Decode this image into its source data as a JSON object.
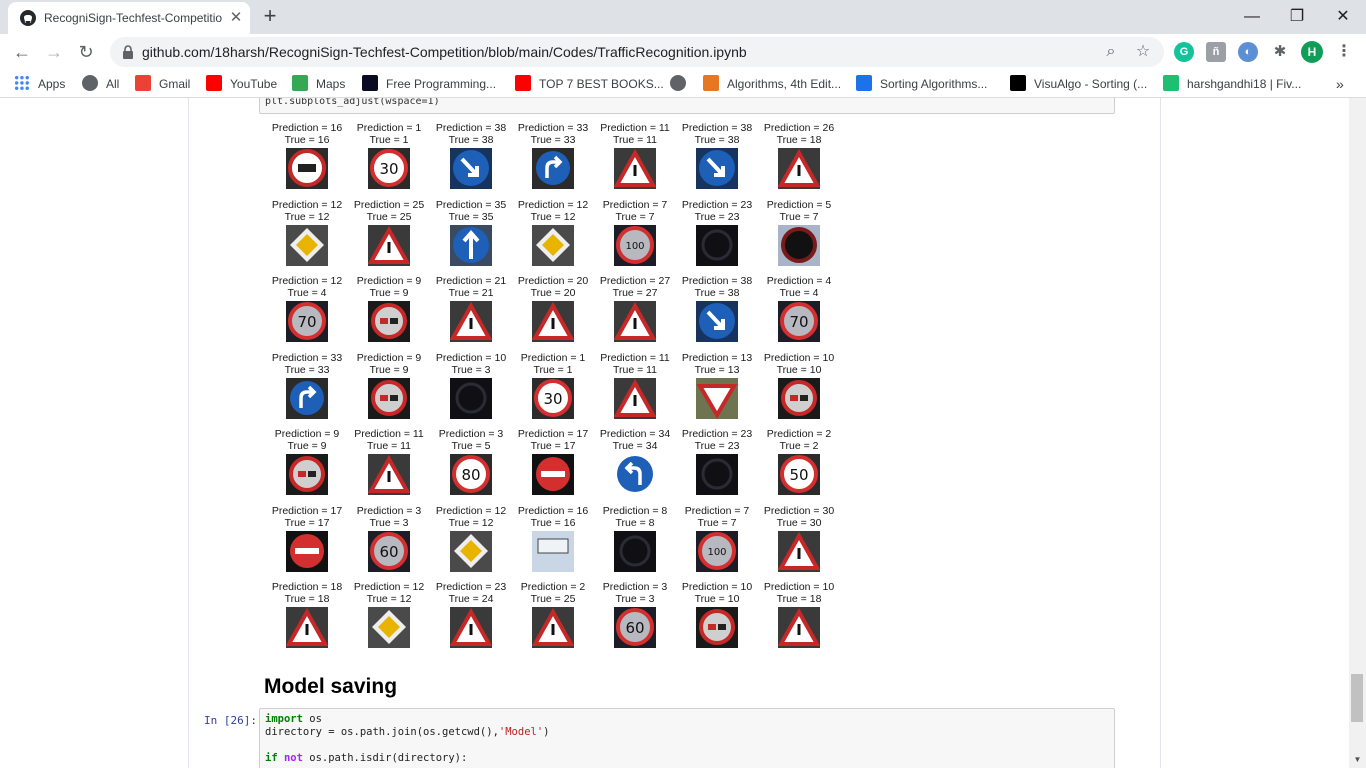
{
  "tab": {
    "title": "RecogniSign-Techfest-Competitio",
    "close": "✕",
    "new": "+"
  },
  "window": {
    "minimize": "—",
    "restore": "❐",
    "close": "✕"
  },
  "toolbar": {
    "url_host": "github.com",
    "url_path": "/18harsh/RecogniSign-Techfest-Competition/blob/main/Codes/TrafficRecognition.ipynb",
    "profile_initial": "H"
  },
  "bookmarks": [
    {
      "label": "Apps",
      "icon": "apps-grid-icon",
      "color": "#4285f4"
    },
    {
      "label": "All",
      "icon": "globe-icon",
      "color": "#5f6368"
    },
    {
      "label": "Gmail",
      "icon": "gmail-icon",
      "color": "#ea4335"
    },
    {
      "label": "YouTube",
      "icon": "youtube-icon",
      "color": "#ff0000"
    },
    {
      "label": "Maps",
      "icon": "maps-pin-icon",
      "color": "#34a853"
    },
    {
      "label": "Free Programming...",
      "icon": "fcc-icon",
      "color": "#0a0a23"
    },
    {
      "label": "TOP 7 BEST BOOKS...",
      "icon": "youtube-icon",
      "color": "#ff0000"
    },
    {
      "label": "",
      "icon": "globe-icon",
      "color": "#5f6368"
    },
    {
      "label": "Algorithms, 4th Edit...",
      "icon": "princeton-shield-icon",
      "color": "#e87722"
    },
    {
      "label": "Sorting Algorithms...",
      "icon": "sorting-icon",
      "color": "#1a73e8"
    },
    {
      "label": "VisuAlgo - Sorting (...",
      "icon": "visualgo-icon",
      "color": "#000000"
    },
    {
      "label": "harshgandhi18 | Fiv...",
      "icon": "fiverr-icon",
      "color": "#1dbf73"
    }
  ],
  "notebook": {
    "prev_code": "plt.subplots_adjust(wspace=1)",
    "grid": [
      [
        {
          "p": "Prediction = 16",
          "t": "True = 16",
          "sign": "truck"
        },
        {
          "p": "Prediction = 1",
          "t": "True = 1",
          "sign": "30"
        },
        {
          "p": "Prediction = 38",
          "t": "True = 38",
          "sign": "keepright"
        },
        {
          "p": "Prediction = 33",
          "t": "True = 33",
          "sign": "turnright"
        },
        {
          "p": "Prediction = 11",
          "t": "True = 11",
          "sign": "tri"
        },
        {
          "p": "Prediction = 38",
          "t": "True = 38",
          "sign": "keepright"
        },
        {
          "p": "Prediction = 26",
          "t": "True = 18",
          "sign": "tri"
        }
      ],
      [
        {
          "p": "Prediction = 12",
          "t": "True = 12",
          "sign": "priority"
        },
        {
          "p": "Prediction = 25",
          "t": "True = 25",
          "sign": "tri"
        },
        {
          "p": "Prediction = 35",
          "t": "True = 35",
          "sign": "ahead"
        },
        {
          "p": "Prediction = 12",
          "t": "True = 12",
          "sign": "priority"
        },
        {
          "p": "Prediction = 7",
          "t": "True = 7",
          "sign": "100"
        },
        {
          "p": "Prediction = 23",
          "t": "True = 23",
          "sign": "dark"
        },
        {
          "p": "Prediction = 5",
          "t": "True = 7",
          "sign": "circle"
        }
      ],
      [
        {
          "p": "Prediction = 12",
          "t": "True = 4",
          "sign": "70"
        },
        {
          "p": "Prediction = 9",
          "t": "True = 9",
          "sign": "nopass"
        },
        {
          "p": "Prediction = 21",
          "t": "True = 21",
          "sign": "tri"
        },
        {
          "p": "Prediction = 20",
          "t": "True = 20",
          "sign": "tri"
        },
        {
          "p": "Prediction = 27",
          "t": "True = 27",
          "sign": "tri"
        },
        {
          "p": "Prediction = 38",
          "t": "True = 38",
          "sign": "keepright"
        },
        {
          "p": "Prediction = 4",
          "t": "True = 4",
          "sign": "70"
        }
      ],
      [
        {
          "p": "Prediction = 33",
          "t": "True = 33",
          "sign": "turnright"
        },
        {
          "p": "Prediction = 9",
          "t": "True = 9",
          "sign": "nopass"
        },
        {
          "p": "Prediction = 10",
          "t": "True = 3",
          "sign": "dark"
        },
        {
          "p": "Prediction = 1",
          "t": "True = 1",
          "sign": "30"
        },
        {
          "p": "Prediction = 11",
          "t": "True = 11",
          "sign": "tri"
        },
        {
          "p": "Prediction = 13",
          "t": "True = 13",
          "sign": "yield"
        },
        {
          "p": "Prediction = 10",
          "t": "True = 10",
          "sign": "nopass"
        }
      ],
      [
        {
          "p": "Prediction = 9",
          "t": "True = 9",
          "sign": "nopass"
        },
        {
          "p": "Prediction = 11",
          "t": "True = 11",
          "sign": "tri"
        },
        {
          "p": "Prediction = 3",
          "t": "True = 5",
          "sign": "80"
        },
        {
          "p": "Prediction = 17",
          "t": "True = 17",
          "sign": "noentry"
        },
        {
          "p": "Prediction = 34",
          "t": "True = 34",
          "sign": "turnleft"
        },
        {
          "p": "Prediction = 23",
          "t": "True = 23",
          "sign": "dark"
        },
        {
          "p": "Prediction = 2",
          "t": "True = 2",
          "sign": "50"
        }
      ],
      [
        {
          "p": "Prediction = 17",
          "t": "True = 17",
          "sign": "noentry"
        },
        {
          "p": "Prediction = 3",
          "t": "True = 3",
          "sign": "60"
        },
        {
          "p": "Prediction = 12",
          "t": "True = 12",
          "sign": "priority"
        },
        {
          "p": "Prediction = 16",
          "t": "True = 16",
          "sign": "panel"
        },
        {
          "p": "Prediction = 8",
          "t": "True = 8",
          "sign": "dark"
        },
        {
          "p": "Prediction = 7",
          "t": "True = 7",
          "sign": "100"
        },
        {
          "p": "Prediction = 30",
          "t": "True = 30",
          "sign": "tri"
        }
      ],
      [
        {
          "p": "Prediction = 18",
          "t": "True = 18",
          "sign": "tri"
        },
        {
          "p": "Prediction = 12",
          "t": "True = 12",
          "sign": "priority"
        },
        {
          "p": "Prediction = 23",
          "t": "True = 24",
          "sign": "tri"
        },
        {
          "p": "Prediction = 2",
          "t": "True = 25",
          "sign": "tri"
        },
        {
          "p": "Prediction = 3",
          "t": "True = 3",
          "sign": "60"
        },
        {
          "p": "Prediction = 10",
          "t": "True = 10",
          "sign": "nopass"
        },
        {
          "p": "Prediction = 10",
          "t": "True = 18",
          "sign": "tri"
        }
      ]
    ],
    "heading": "Model saving",
    "prompt": "In [26]:",
    "code": {
      "l1_kw": "import",
      "l1_rest": " os",
      "l2_a": "directory = os.path.join(os.getcwd(),",
      "l2_str": "'Model'",
      "l2_b": ")",
      "l4_kw": "if",
      "l4_kw2": " not",
      "l4_rest": " os.path.isdir(directory):"
    }
  }
}
